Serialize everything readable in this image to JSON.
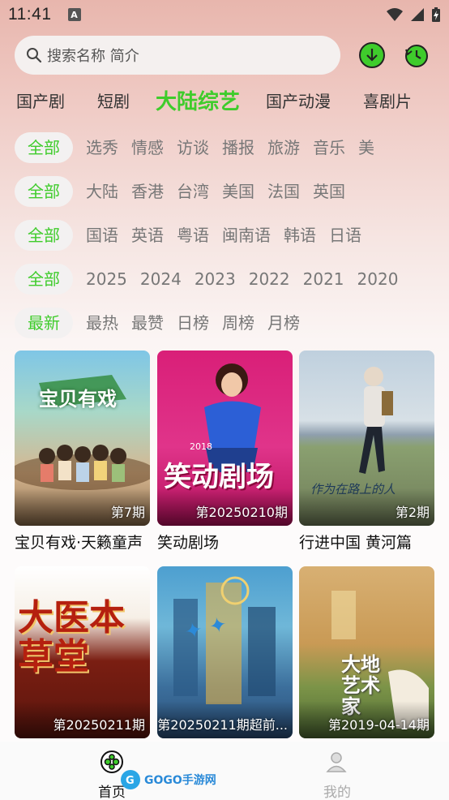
{
  "status": {
    "time": "11:41",
    "a_badge": "A"
  },
  "search": {
    "placeholder": "搜索名称 简介"
  },
  "main_tabs": [
    "国产剧",
    "短剧",
    "大陆综艺",
    "国产动漫",
    "喜剧片"
  ],
  "active_main_tab": "大陆综艺",
  "filters": {
    "genre": [
      "全部",
      "选秀",
      "情感",
      "访谈",
      "播报",
      "旅游",
      "音乐",
      "美"
    ],
    "region": [
      "全部",
      "大陆",
      "香港",
      "台湾",
      "美国",
      "法国",
      "英国"
    ],
    "language": [
      "全部",
      "国语",
      "英语",
      "粤语",
      "闽南语",
      "韩语",
      "日语"
    ],
    "year": [
      "全部",
      "2025",
      "2024",
      "2023",
      "2022",
      "2021",
      "2020"
    ],
    "sort": [
      "最新",
      "最热",
      "最赞",
      "日榜",
      "周榜",
      "月榜"
    ]
  },
  "cards": [
    {
      "title": "宝贝有戏·天籁童声",
      "episode": "第7期",
      "poster_text": "宝贝有戏"
    },
    {
      "title": "笑动剧场",
      "episode": "第20250210期",
      "poster_text": "笑动剧场",
      "poster_year": "2018"
    },
    {
      "title": "行进中国 黄河篇",
      "episode": "第2期",
      "poster_text": "作为在路上的人"
    },
    {
      "title": "",
      "episode": "第20250211期",
      "poster_text": "大医本草堂"
    },
    {
      "title": "",
      "episode": "第20250211期超前...",
      "poster_text": ""
    },
    {
      "title": "",
      "episode": "第2019-04-14期",
      "poster_text": "大地艺术家"
    }
  ],
  "bottom_nav": {
    "home_label": "首页",
    "mine_label": "我的",
    "watermark": "GOGO手游网"
  },
  "colors": {
    "accent": "#3fcc2c",
    "background_top": "#e8b6ad"
  }
}
